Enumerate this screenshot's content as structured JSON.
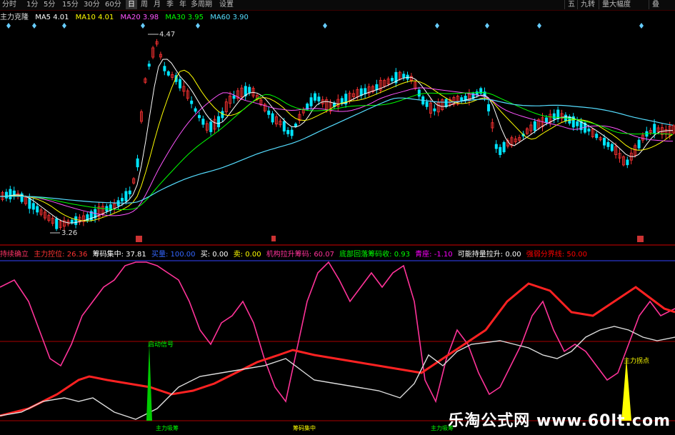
{
  "toolbar": {
    "tabs": [
      "分时",
      "1分",
      "5分",
      "15分",
      "30分",
      "60分",
      "日",
      "周",
      "月",
      "季",
      "年",
      "多周期",
      "设置"
    ],
    "active_tab": 6,
    "right_buttons": [
      "五",
      "九转",
      "量大幅度",
      "叠"
    ]
  },
  "ma_legend": {
    "name": "主力克隆",
    "items": [
      {
        "label": "MA5",
        "value": "4.01",
        "color": "#ffffff"
      },
      {
        "label": "MA10",
        "value": "4.01",
        "color": "#ffff00"
      },
      {
        "label": "MA20",
        "value": "3.98",
        "color": "#ff55ff"
      },
      {
        "label": "MA30",
        "value": "3.95",
        "color": "#00ff00"
      },
      {
        "label": "MA60",
        "value": "3.90",
        "color": "#55ddff"
      }
    ]
  },
  "price_labels": {
    "high": "4.47",
    "low": "3.26"
  },
  "indicator_legend": {
    "name": "持续确立",
    "items": [
      {
        "label": "主力控位:",
        "value": "26.36",
        "color": "#ff3333"
      },
      {
        "label": "筹码集中:",
        "value": "37.81",
        "color": "#ffffff"
      },
      {
        "label": "买量:",
        "value": "100.00",
        "color": "#3366ff"
      },
      {
        "label": "买:",
        "value": "0.00",
        "color": "#ffffff"
      },
      {
        "label": "卖:",
        "value": "0.00",
        "color": "#ffff00"
      },
      {
        "label": "机构拉升筹码:",
        "value": "60.07",
        "color": "#ff3399"
      },
      {
        "label": "底部回落筹码收:",
        "value": "0.93",
        "color": "#00ff00"
      },
      {
        "label": "青座:",
        "value": "-1.10",
        "color": "#ff00ff"
      },
      {
        "label": "可能持量拉升:",
        "value": "0.00",
        "color": "#ffffff"
      },
      {
        "label": "强弱分界线:",
        "value": "50.00",
        "color": "#ff0000"
      }
    ]
  },
  "annotations": {
    "signal_a": "启动信号",
    "signal_b": "主力拐点",
    "bottom_a": "主力吸筹",
    "bottom_b": "筹码集中",
    "bottom_c": "主力吸筹"
  },
  "watermark": "乐淘公式网 www.60lt.com"
}
